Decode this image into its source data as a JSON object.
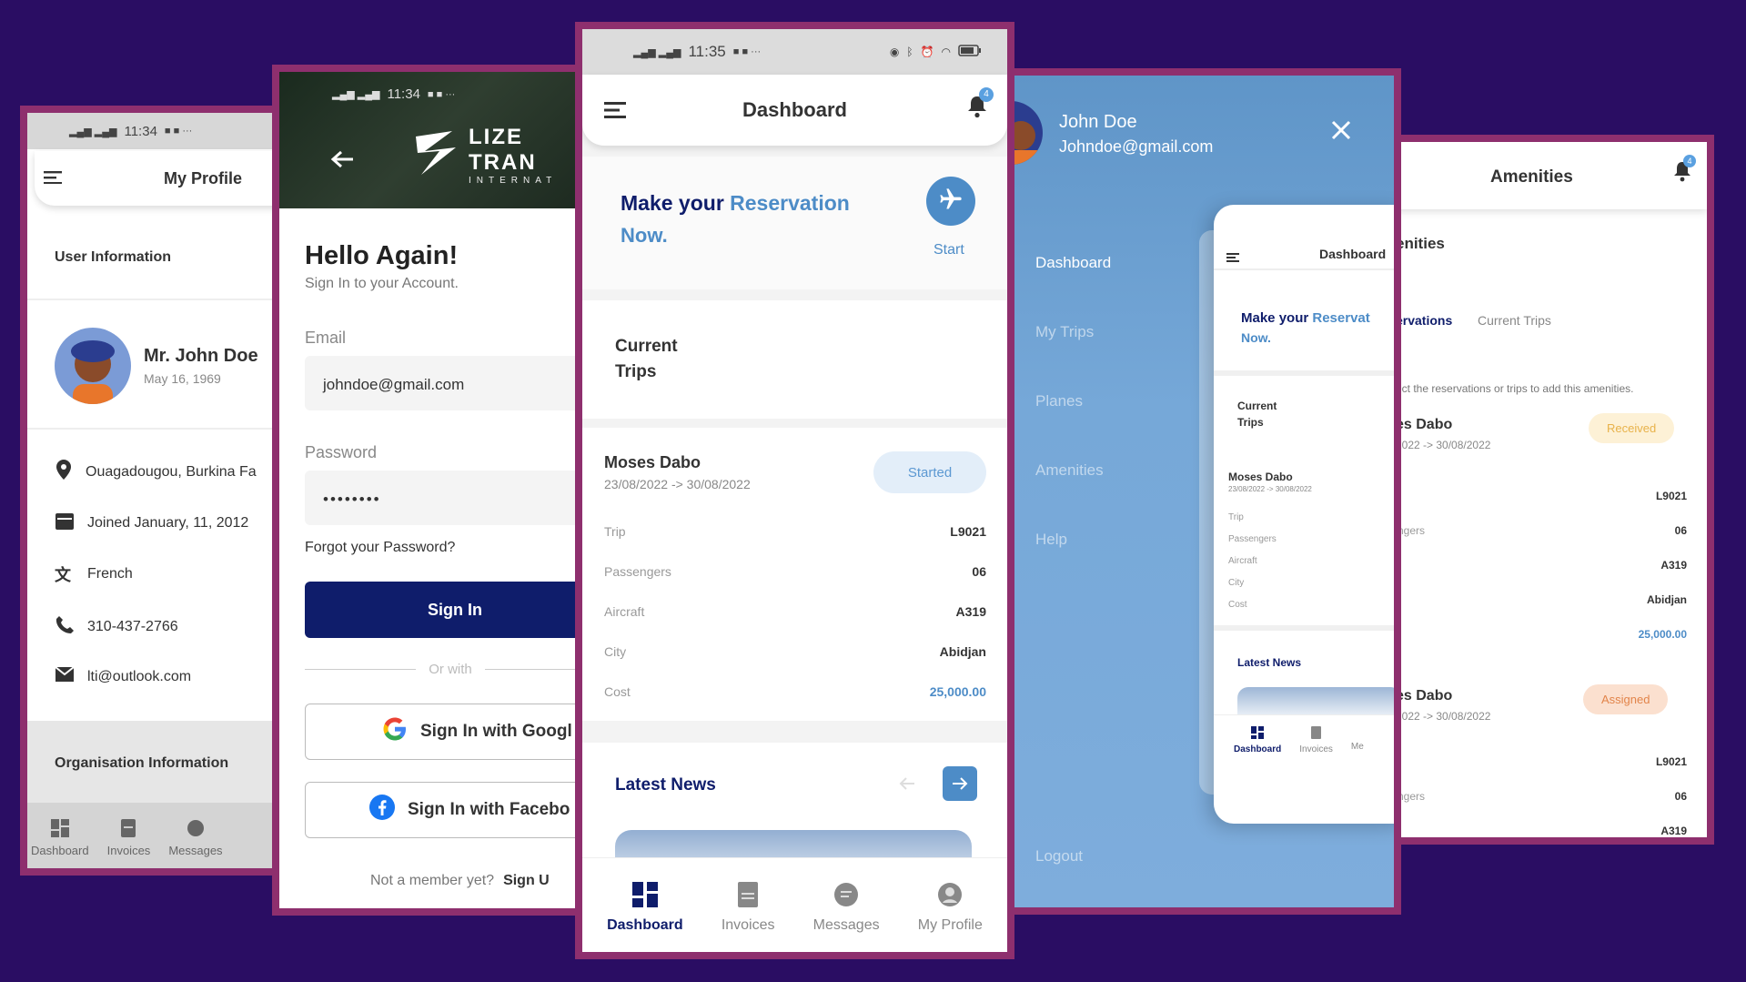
{
  "colors": {
    "background": "#2a0d63",
    "frame_border": "#8e2f6e",
    "navy": "#0f1d6b",
    "accent_blue": "#4d8cc7",
    "drawer_blue": "#76a8d8"
  },
  "profile": {
    "status_time": "11:34",
    "title": "My Profile",
    "user_info_heading": "User Information",
    "name": "Mr. John Doe",
    "birthdate": "May 16, 1969",
    "location": "Ouagadougou, Burkina Fa",
    "joined": "Joined January, 11, 2012",
    "language": "French",
    "phone": "310-437-2766",
    "email": "lti@outlook.com",
    "org_heading": "Organisation Information",
    "nav": {
      "dashboard": "Dashboard",
      "invoices": "Invoices",
      "messages": "Messages"
    }
  },
  "signin": {
    "status_time": "11:34",
    "brand": "LIZE TRAN",
    "brand_sub": "INTERNAT",
    "heading": "Hello Again!",
    "subheading": "Sign In to your Account.",
    "email_label": "Email",
    "email_value": "johndoe@gmail.com",
    "password_label": "Password",
    "password_value": "••••••••",
    "forgot": "Forgot your Password?",
    "signin_button": "Sign In",
    "or_with": "Or with",
    "google_button": "Sign In with Googl",
    "facebook_button": "Sign In with Facebo",
    "not_member": "Not a member yet?",
    "signup": "Sign U"
  },
  "dashboard": {
    "status_time": "11:35",
    "title": "Dashboard",
    "notification_count": "4",
    "reservation_make": "Make your",
    "reservation_word": "Reservation",
    "reservation_now": "Now.",
    "start_label": "Start",
    "current_trips_line1": "Current",
    "current_trips_line2": "Trips",
    "trip": {
      "name": "Moses Dabo",
      "dates": "23/08/2022 -> 30/08/2022",
      "status": "Started",
      "rows": [
        {
          "label": "Trip",
          "value": "L9021"
        },
        {
          "label": "Passengers",
          "value": "06"
        },
        {
          "label": "Aircraft",
          "value": "A319"
        },
        {
          "label": "City",
          "value": "Abidjan"
        },
        {
          "label": "Cost",
          "value": "25,000.00"
        }
      ]
    },
    "latest_news": "Latest News",
    "nav": {
      "dashboard": "Dashboard",
      "invoices": "Invoices",
      "messages": "Messages",
      "profile": "My Profile"
    }
  },
  "drawer": {
    "name": "John Doe",
    "email": "Johndoe@gmail.com",
    "menu": [
      "Dashboard",
      "My Trips",
      "Planes",
      "Amenities",
      "Help"
    ],
    "logout": "Logout",
    "mini": {
      "title": "Dashboard",
      "make": "Make your",
      "word": "Reservat",
      "now": "Now.",
      "current1": "Current",
      "current2": "Trips",
      "trip_name": "Moses Dabo",
      "trip_dates": "23/08/2022 -> 30/08/2022",
      "labels": [
        "Trip",
        "Passengers",
        "Aircraft",
        "City",
        "Cost"
      ],
      "latest_news": "Latest News",
      "nav": {
        "dashboard": "Dashboard",
        "invoices": "Invoices",
        "messages": "Me"
      }
    }
  },
  "amenities": {
    "title": "Amenities",
    "notification_count": "4",
    "section": "enities",
    "tab_reservations": "ervations",
    "tab_current": "Current Trips",
    "hint": "ect the reservations or trips to add this amenities.",
    "cards": [
      {
        "name": "es Dabo",
        "dates": "2022 -> 30/08/2022",
        "status": "Received",
        "rows": [
          {
            "label": "",
            "value": "L9021"
          },
          {
            "label": "ngers",
            "value": "06"
          },
          {
            "label": "t",
            "value": "A319"
          },
          {
            "label": "",
            "value": "Abidjan"
          },
          {
            "label": "",
            "value": "25,000.00"
          }
        ]
      },
      {
        "name": "es Dabo",
        "dates": "2022 -> 30/08/2022",
        "status": "Assigned",
        "rows": [
          {
            "label": "",
            "value": "L9021"
          },
          {
            "label": "ngers",
            "value": "06"
          },
          {
            "label": "t",
            "value": "A319"
          }
        ]
      }
    ]
  }
}
